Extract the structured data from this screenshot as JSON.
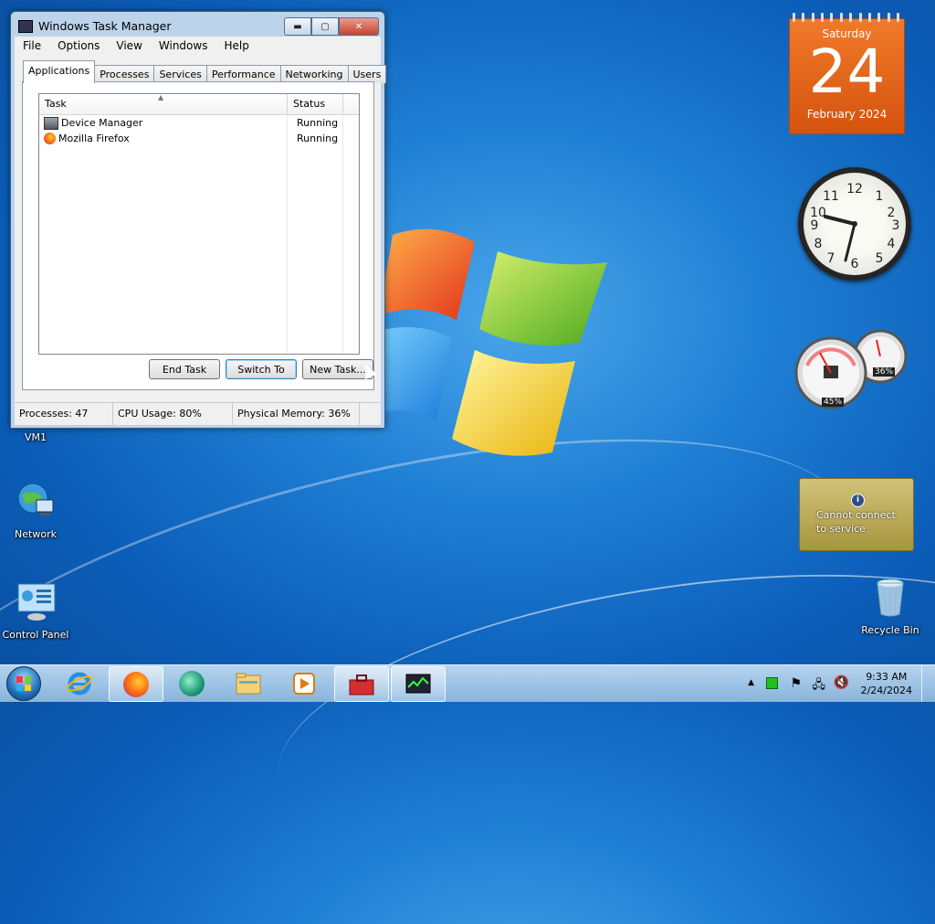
{
  "task_manager": {
    "title": "Windows Task Manager",
    "menu": [
      "File",
      "Options",
      "View",
      "Windows",
      "Help"
    ],
    "tabs": [
      "Applications",
      "Processes",
      "Services",
      "Performance",
      "Networking",
      "Users"
    ],
    "active_tab": "Applications",
    "columns": {
      "task": "Task",
      "status": "Status"
    },
    "tasks": [
      {
        "name": "Device Manager",
        "status": "Running",
        "icon": "device-manager-icon"
      },
      {
        "name": "Mozilla Firefox",
        "status": "Running",
        "icon": "firefox-icon"
      }
    ],
    "buttons": {
      "end_task": "End Task",
      "switch_to": "Switch To",
      "new_task": "New Task..."
    },
    "status": {
      "processes": "Processes: 47",
      "cpu": "CPU Usage: 80%",
      "memory": "Physical Memory: 36%"
    }
  },
  "desktop_icons": {
    "vm": "VM1",
    "network": "Network",
    "control_panel": "Control Panel",
    "recycle_bin": "Recycle Bin"
  },
  "calendar": {
    "weekday": "Saturday",
    "day": "24",
    "month_year": "February 2024"
  },
  "cpu_meter": {
    "cpu": "45%",
    "memory": "36%"
  },
  "weather": {
    "message_line1": "Cannot connect",
    "message_line2": "to service",
    "info_glyph": "i"
  },
  "taskbar": {
    "time": "9:33 AM",
    "date": "2/24/2024"
  },
  "colors": {
    "calendar_orange": "#e56a1e",
    "desktop_blue": "#1f7fd4"
  }
}
